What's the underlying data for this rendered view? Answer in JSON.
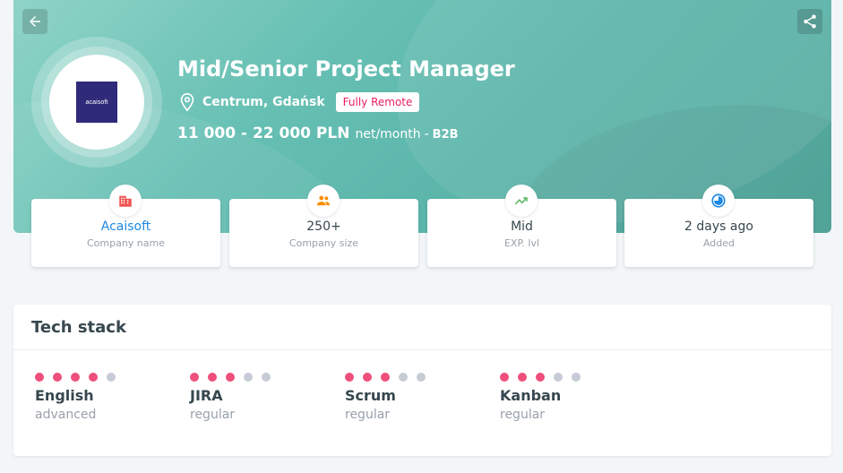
{
  "header": {
    "title": "Mid/Senior Project Manager",
    "location": "Centrum, Gdańsk",
    "remote_badge": "Fully Remote",
    "salary": "11 000 - 22 000 PLN",
    "salary_unit": "net/month",
    "salary_sep": "-",
    "contract": "B2B",
    "logo_text": "acaisoft",
    "icons": {
      "back": "arrow-left-icon",
      "share": "share-icon",
      "location": "map-pin-icon"
    }
  },
  "info_cards": [
    {
      "value": "Acaisoft",
      "label": "Company name",
      "icon": "building-icon",
      "icon_color": "#ef5350"
    },
    {
      "value": "250+",
      "label": "Company size",
      "icon": "people-icon",
      "icon_color": "#fb8c00"
    },
    {
      "value": "Mid",
      "label": "EXP. lvl",
      "icon": "trend-up-icon",
      "icon_color": "#66bb6a"
    },
    {
      "value": "2 days ago",
      "label": "Added",
      "icon": "clock-icon",
      "icon_color": "#1e88e5"
    }
  ],
  "tech_stack": {
    "title": "Tech stack",
    "skills": [
      {
        "name": "English",
        "level": "advanced",
        "rating": 4,
        "max": 5
      },
      {
        "name": "JIRA",
        "level": "regular",
        "rating": 3,
        "max": 5
      },
      {
        "name": "Scrum",
        "level": "regular",
        "rating": 3,
        "max": 5
      },
      {
        "name": "Kanban",
        "level": "regular",
        "rating": 3,
        "max": 5
      }
    ]
  },
  "colors": {
    "accent_pink": "#ef4f7b",
    "hero_teal": "#5bb5a9",
    "link_blue": "#1e88e5"
  }
}
